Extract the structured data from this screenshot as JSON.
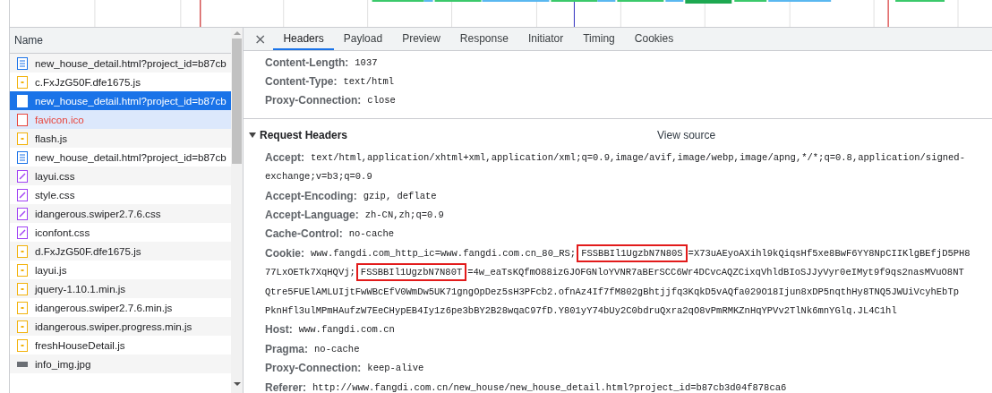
{
  "request_list": {
    "column": "Name",
    "rows": [
      {
        "name": "new_house_detail.html?project_id=b87cb",
        "kind": "document",
        "selected": false,
        "failed": false,
        "hovered": false
      },
      {
        "name": "c.FxJzG50F.dfe1675.js",
        "kind": "script",
        "selected": false,
        "failed": false,
        "hovered": false
      },
      {
        "name": "new_house_detail.html?project_id=b87cb",
        "kind": "document",
        "selected": true,
        "failed": false,
        "hovered": false
      },
      {
        "name": "favicon.ico",
        "kind": "other",
        "selected": false,
        "failed": true,
        "hovered": true
      },
      {
        "name": "flash.js",
        "kind": "script",
        "selected": false,
        "failed": false,
        "hovered": false
      },
      {
        "name": "new_house_detail.html?project_id=b87cb",
        "kind": "document",
        "selected": false,
        "failed": false,
        "hovered": false
      },
      {
        "name": "layui.css",
        "kind": "stylesheet",
        "selected": false,
        "failed": false,
        "hovered": false
      },
      {
        "name": "style.css",
        "kind": "stylesheet",
        "selected": false,
        "failed": false,
        "hovered": false
      },
      {
        "name": "idangerous.swiper2.7.6.css",
        "kind": "stylesheet",
        "selected": false,
        "failed": false,
        "hovered": false
      },
      {
        "name": "iconfont.css",
        "kind": "stylesheet",
        "selected": false,
        "failed": false,
        "hovered": false
      },
      {
        "name": "d.FxJzG50F.dfe1675.js",
        "kind": "script",
        "selected": false,
        "failed": false,
        "hovered": false
      },
      {
        "name": "layui.js",
        "kind": "script",
        "selected": false,
        "failed": false,
        "hovered": false
      },
      {
        "name": "jquery-1.10.1.min.js",
        "kind": "script",
        "selected": false,
        "failed": false,
        "hovered": false
      },
      {
        "name": "idangerous.swiper2.7.6.min.js",
        "kind": "script",
        "selected": false,
        "failed": false,
        "hovered": false
      },
      {
        "name": "idangerous.swiper.progress.min.js",
        "kind": "script",
        "selected": false,
        "failed": false,
        "hovered": false
      },
      {
        "name": "freshHouseDetail.js",
        "kind": "script",
        "selected": false,
        "failed": false,
        "hovered": false
      },
      {
        "name": "info_img.jpg",
        "kind": "image",
        "selected": false,
        "failed": false,
        "hovered": false
      }
    ]
  },
  "details": {
    "close": "×",
    "tabs": [
      {
        "label": "Headers",
        "selected": true
      },
      {
        "label": "Payload",
        "selected": false
      },
      {
        "label": "Preview",
        "selected": false
      },
      {
        "label": "Response",
        "selected": false
      },
      {
        "label": "Initiator",
        "selected": false
      },
      {
        "label": "Timing",
        "selected": false
      },
      {
        "label": "Cookies",
        "selected": false
      }
    ],
    "response_headers": [
      {
        "name": "Content-Length:",
        "lines": [
          [
            {
              "text": "1037",
              "boxed": false
            }
          ]
        ]
      },
      {
        "name": "Content-Type:",
        "lines": [
          [
            {
              "text": "text/html",
              "boxed": false
            }
          ]
        ]
      },
      {
        "name": "Proxy-Connection:",
        "lines": [
          [
            {
              "text": "close",
              "boxed": false
            }
          ]
        ]
      }
    ],
    "request_headers": {
      "title": "Request Headers",
      "expanded": true,
      "view_source": "View source",
      "headers": [
        {
          "name": "Accept:",
          "lines": [
            [
              {
                "text": "text/html,application/xhtml+xml,application/xml;q=0.9,image/avif,image/webp,image/apng,*/*;q=0.8,application/signed-",
                "boxed": false
              }
            ],
            [
              {
                "text": "exchange;v=b3;q=0.9",
                "boxed": false
              }
            ]
          ]
        },
        {
          "name": "Accept-Encoding:",
          "lines": [
            [
              {
                "text": "gzip, deflate",
                "boxed": false
              }
            ]
          ]
        },
        {
          "name": "Accept-Language:",
          "lines": [
            [
              {
                "text": "zh-CN,zh;q=0.9",
                "boxed": false
              }
            ]
          ]
        },
        {
          "name": "Cache-Control:",
          "lines": [
            [
              {
                "text": "no-cache",
                "boxed": false
              }
            ]
          ]
        },
        {
          "name": "Cookie:",
          "lines": [
            [
              {
                "text": "www.fangdi.com_http_ic=www.fangdi.com.cn_80_RS;",
                "boxed": false
              },
              {
                "text": "FSSBBIl1UgzbN7N80S",
                "boxed": true
              },
              {
                "text": "=X73uAEyoAXihl9kQiqsHf5xe8BwF6YY8NpCIIKlgBEfjD5PH8",
                "boxed": false
              }
            ],
            [
              {
                "text": "77LxOETk7XqHQVj;",
                "boxed": false
              },
              {
                "text": "FSSBBIl1UgzbN7N80T",
                "boxed": true
              },
              {
                "text": "=4w_eaTsKQfmO88izGJOFGNloYVNR7aBErSCC6Wr4DCvcAQZCixqVhldBIoSJJyVyr0eIMyt9f9qs2nasMVuO8NT",
                "boxed": false
              }
            ],
            [
              {
                "text": "Qtre5FUElAMLUIjtFwWBcEfV0WmDw5UK71gngOpDez5sH3PFcb2.ofnAz4If7fM802gBhtjjfq3KqkD5vAQfa029O18Ijun8xDP5nqthHy8TNQ5JWUiVcyhEbTp",
                "boxed": false
              }
            ],
            [
              {
                "text": "PknHfl3ulMPmHAufzW7EeCHypEB4Iy1z6pe3bBY2B28wqaC97fD.Y801yY74bUy2C0bdruQxra2qO8vPmRMKZnHqYPVv2TlNk6mnYGlq.JL4C1hl",
                "boxed": false
              }
            ]
          ]
        },
        {
          "name": "Host:",
          "lines": [
            [
              {
                "text": "www.fangdi.com.cn",
                "boxed": false
              }
            ]
          ]
        },
        {
          "name": "Pragma:",
          "lines": [
            [
              {
                "text": "no-cache",
                "boxed": false
              }
            ]
          ]
        },
        {
          "name": "Proxy-Connection:",
          "lines": [
            [
              {
                "text": "keep-alive",
                "boxed": false
              }
            ]
          ]
        },
        {
          "name": "Referer:",
          "lines": [
            [
              {
                "text": "http://www.fangdi.com.cn/new_house/new_house_detail.html?project_id=b87cb3d04f878ca6",
                "boxed": false
              }
            ]
          ]
        }
      ]
    }
  }
}
